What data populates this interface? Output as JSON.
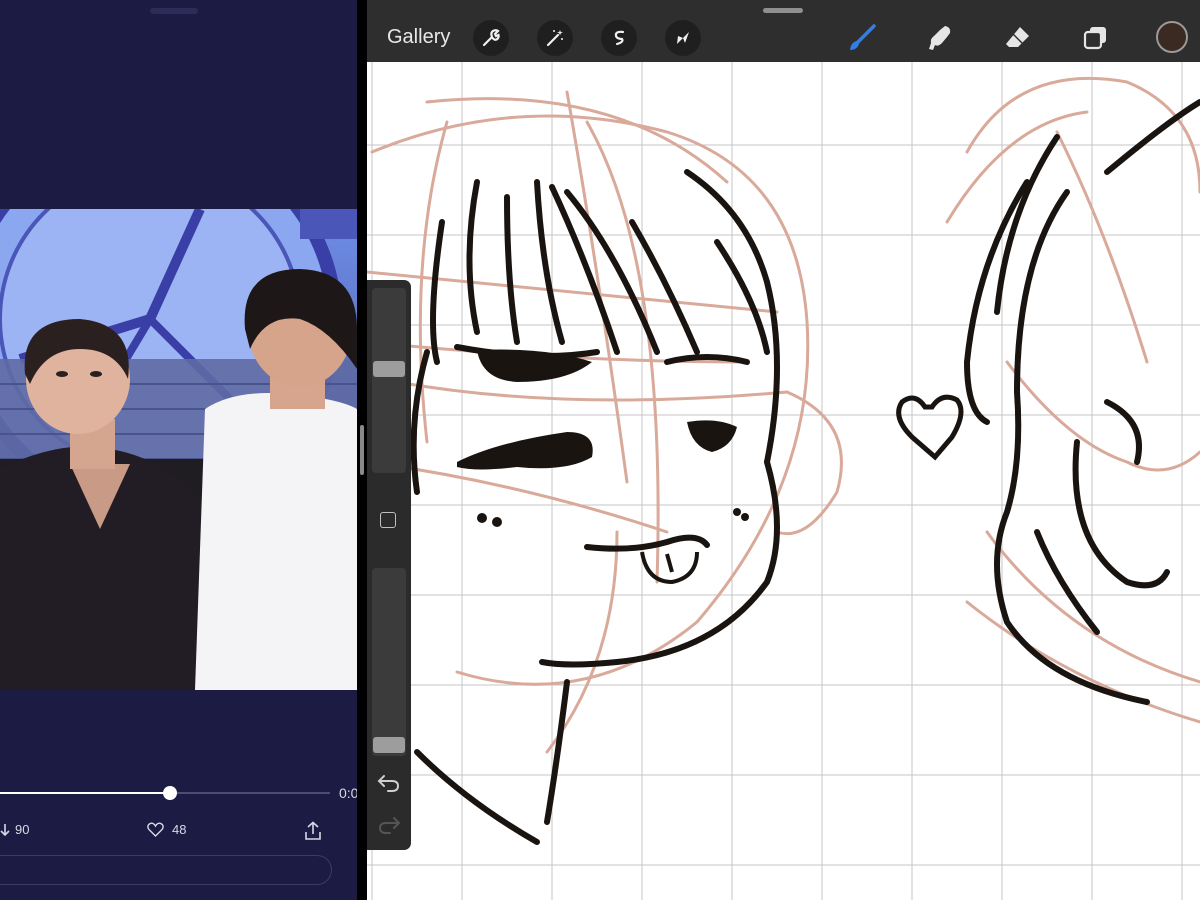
{
  "twitter_video": {
    "time_label": "0:0",
    "playback_progress": 0.515,
    "retweets": "90",
    "likes": "48",
    "icons": [
      "retweet-icon",
      "heart-icon",
      "share-icon"
    ],
    "background_color": "#1b1b44"
  },
  "procreate": {
    "gallery_label": "Gallery",
    "left_tools": [
      "wrench-icon",
      "magic-wand-icon",
      "selection-icon",
      "transform-arrow-icon"
    ],
    "right_tools": [
      "brush-icon",
      "smudge-icon",
      "eraser-icon",
      "layers-icon"
    ],
    "active_tool": "brush-icon",
    "current_color": "#3a2a22",
    "brush_size_level": 0.57,
    "brush_opacity_level": 0.02,
    "canvas": {
      "drawing_guide": "grid",
      "sketch_color": "#d9a99a",
      "ink_color": "#1a1410"
    }
  }
}
